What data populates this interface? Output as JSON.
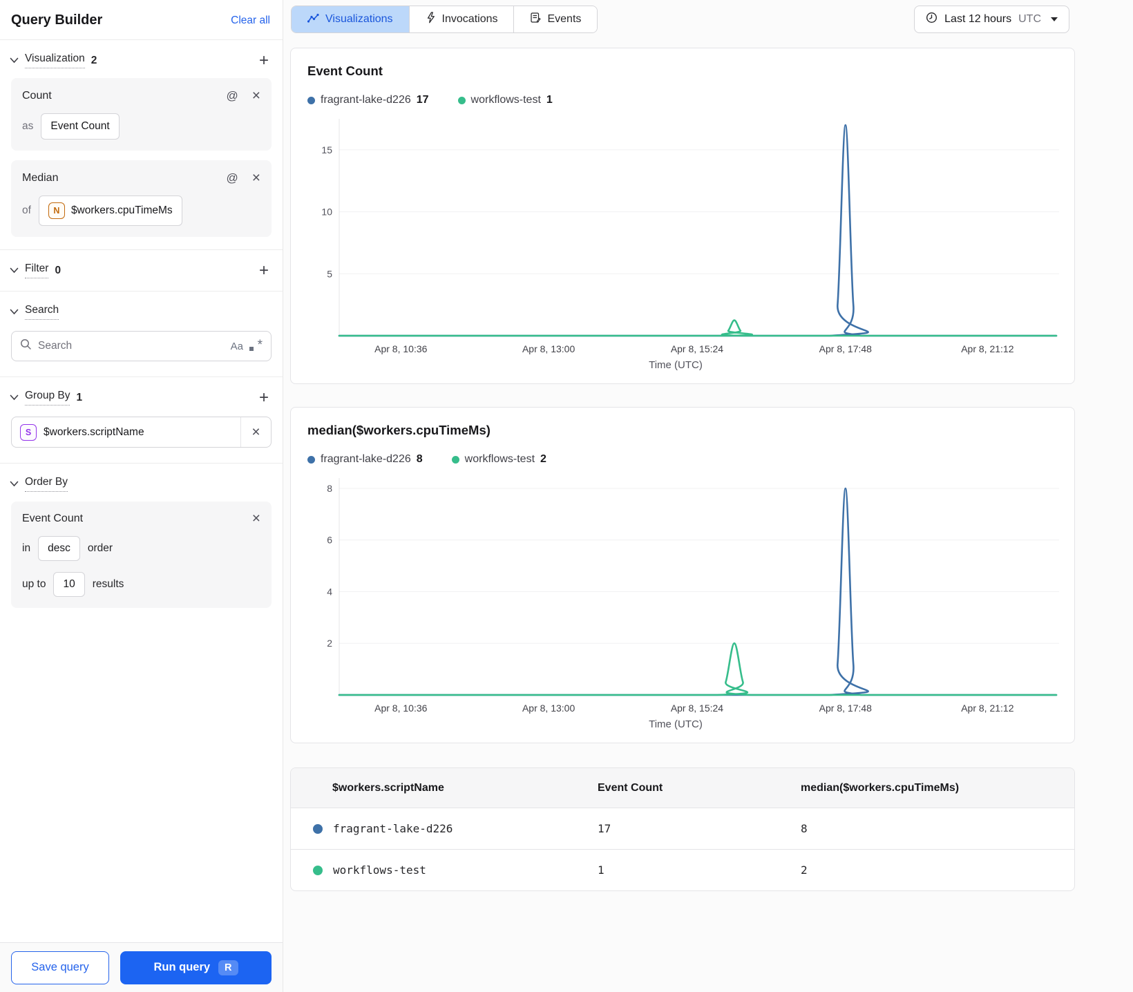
{
  "sidebar": {
    "title": "Query Builder",
    "clear_all": "Clear all",
    "sections": {
      "visualization": {
        "label": "Visualization",
        "count": "2"
      },
      "filter": {
        "label": "Filter",
        "count": "0"
      },
      "search": {
        "label": "Search"
      },
      "group_by": {
        "label": "Group By",
        "count": "1"
      },
      "order_by": {
        "label": "Order By"
      }
    },
    "visualizations": [
      {
        "title": "Count",
        "prefix": "as",
        "value": "Event Count"
      },
      {
        "title": "Median",
        "prefix": "of",
        "badge": "N",
        "value": "$workers.cpuTimeMs"
      }
    ],
    "search_input": {
      "placeholder": "Search",
      "case_icon": "Aa"
    },
    "group_by_item": {
      "badge": "S",
      "value": "$workers.scriptName"
    },
    "order_by_item": {
      "title": "Event Count",
      "in_label": "in",
      "direction": "desc",
      "order_label": "order",
      "upto_label": "up to",
      "limit": "10",
      "results_label": "results"
    },
    "footer": {
      "save": "Save query",
      "run": "Run query",
      "shortcut": "R"
    }
  },
  "tabs": [
    {
      "label": "Visualizations",
      "active": true
    },
    {
      "label": "Invocations",
      "active": false
    },
    {
      "label": "Events",
      "active": false
    }
  ],
  "time_range": {
    "label": "Last 12 hours",
    "timezone": "UTC"
  },
  "colors": {
    "series_blue": "#3e71a8",
    "series_green": "#36bd8b",
    "accent_blue": "#1c64f2",
    "link_blue": "#2563eb",
    "tab_active_bg": "#bcd8fa"
  },
  "chart_data": [
    {
      "type": "line",
      "title": "Event Count",
      "xlabel": "Time (UTC)",
      "ylim": [
        0,
        17.5
      ],
      "yticks": [
        5,
        10,
        15
      ],
      "grid": true,
      "legend_position": "top",
      "xticks": [
        {
          "f": 0.086,
          "label": "Apr 8, 10:36"
        },
        {
          "f": 0.292,
          "label": "Apr 8, 13:00"
        },
        {
          "f": 0.499,
          "label": "Apr 8, 15:24"
        },
        {
          "f": 0.706,
          "label": "Apr 8, 17:48"
        },
        {
          "f": 0.904,
          "label": "Apr 8, 21:12"
        }
      ],
      "legend": [
        {
          "name": "fragrant-lake-d226",
          "value": "17",
          "color": "#3e71a8"
        },
        {
          "name": "workflows-test",
          "value": "1",
          "color": "#36bd8b"
        }
      ],
      "series": [
        {
          "name": "fragrant-lake-d226",
          "color": "#3e71a8",
          "points": [
            [
              0,
              0
            ],
            [
              0.684,
              0
            ],
            [
              0.695,
              2.5
            ],
            [
              0.706,
              17
            ],
            [
              0.717,
              2.5
            ],
            [
              0.728,
              0
            ],
            [
              1,
              0
            ]
          ]
        },
        {
          "name": "workflows-test",
          "color": "#36bd8b",
          "points": [
            [
              0,
              0
            ],
            [
              0.534,
              0
            ],
            [
              0.5425,
              0.4
            ],
            [
              0.551,
              1.25
            ],
            [
              0.5595,
              0.4
            ],
            [
              0.568,
              0
            ],
            [
              1,
              0
            ]
          ]
        }
      ]
    },
    {
      "type": "line",
      "title": "median($workers.cpuTimeMs)",
      "xlabel": "Time (UTC)",
      "ylim": [
        0,
        8.4
      ],
      "yticks": [
        2,
        4,
        6,
        8
      ],
      "grid": true,
      "legend_position": "top",
      "xticks": [
        {
          "f": 0.086,
          "label": "Apr 8, 10:36"
        },
        {
          "f": 0.292,
          "label": "Apr 8, 13:00"
        },
        {
          "f": 0.499,
          "label": "Apr 8, 15:24"
        },
        {
          "f": 0.706,
          "label": "Apr 8, 17:48"
        },
        {
          "f": 0.904,
          "label": "Apr 8, 21:12"
        }
      ],
      "legend": [
        {
          "name": "fragrant-lake-d226",
          "value": "8",
          "color": "#3e71a8"
        },
        {
          "name": "workflows-test",
          "value": "2",
          "color": "#36bd8b"
        }
      ],
      "series": [
        {
          "name": "fragrant-lake-d226",
          "color": "#3e71a8",
          "points": [
            [
              0,
              0
            ],
            [
              0.684,
              0
            ],
            [
              0.695,
              1.2
            ],
            [
              0.706,
              8
            ],
            [
              0.717,
              1.2
            ],
            [
              0.728,
              0
            ],
            [
              1,
              0
            ]
          ]
        },
        {
          "name": "workflows-test",
          "color": "#36bd8b",
          "points": [
            [
              0,
              0
            ],
            [
              0.527,
              0
            ],
            [
              0.539,
              0.5
            ],
            [
              0.551,
              2
            ],
            [
              0.563,
              0.5
            ],
            [
              0.575,
              0
            ],
            [
              1,
              0
            ]
          ]
        }
      ]
    }
  ],
  "table": {
    "headers": [
      "$workers.scriptName",
      "Event Count",
      "median($workers.cpuTimeMs)"
    ],
    "rows": [
      {
        "color": "#3e71a8",
        "name": "fragrant-lake-d226",
        "event_count": "17",
        "median": "8"
      },
      {
        "color": "#36bd8b",
        "name": "workflows-test",
        "event_count": "1",
        "median": "2"
      }
    ]
  }
}
